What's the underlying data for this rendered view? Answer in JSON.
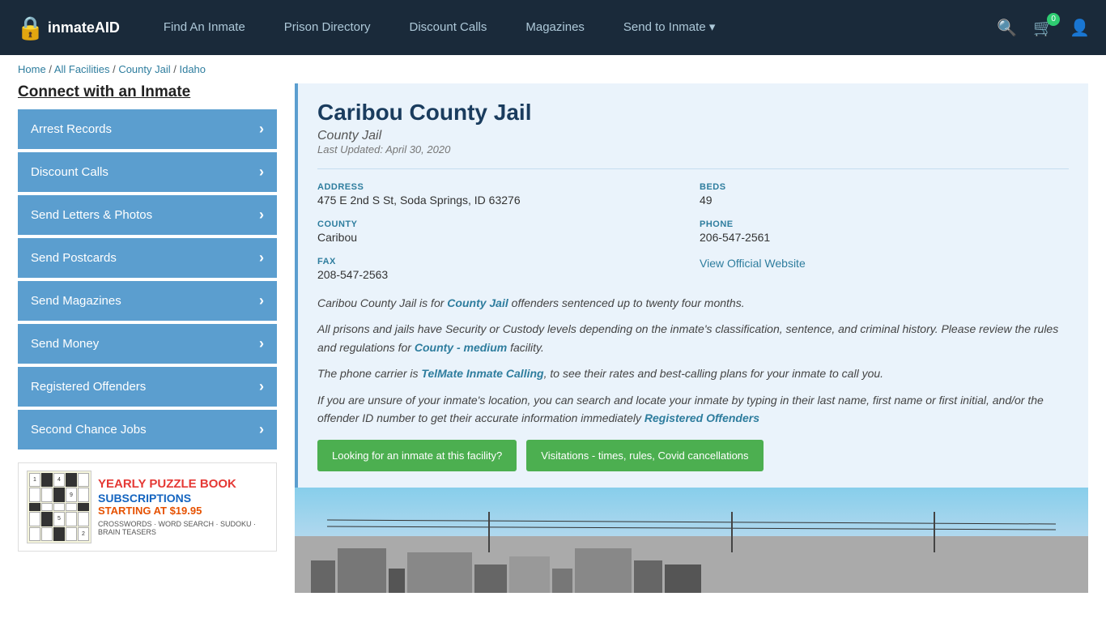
{
  "nav": {
    "logo_text": "inmateAID",
    "links": [
      {
        "label": "Find An Inmate",
        "id": "find-inmate"
      },
      {
        "label": "Prison Directory",
        "id": "prison-directory"
      },
      {
        "label": "Discount Calls",
        "id": "discount-calls"
      },
      {
        "label": "Magazines",
        "id": "magazines"
      },
      {
        "label": "Send to Inmate ▾",
        "id": "send-to-inmate"
      }
    ],
    "cart_count": "0",
    "icons": {
      "search": "🔍",
      "cart": "🛒",
      "user": "👤"
    }
  },
  "breadcrumb": {
    "items": [
      "Home",
      "All Facilities",
      "County Jail",
      "Idaho"
    ]
  },
  "sidebar": {
    "title": "Connect with an Inmate",
    "menu": [
      {
        "label": "Arrest Records",
        "id": "arrest-records"
      },
      {
        "label": "Discount Calls",
        "id": "discount-calls"
      },
      {
        "label": "Send Letters & Photos",
        "id": "send-letters"
      },
      {
        "label": "Send Postcards",
        "id": "send-postcards"
      },
      {
        "label": "Send Magazines",
        "id": "send-magazines"
      },
      {
        "label": "Send Money",
        "id": "send-money"
      },
      {
        "label": "Registered Offenders",
        "id": "registered-offenders"
      },
      {
        "label": "Second Chance Jobs",
        "id": "second-chance-jobs"
      }
    ],
    "ad": {
      "title": "YEARLY PUZZLE BOOK",
      "subtitle": "SUBSCRIPTIONS",
      "price": "STARTING AT $19.95",
      "types": "CROSSWORDS · WORD SEARCH · SUDOKU · BRAIN TEASERS"
    }
  },
  "facility": {
    "name": "Caribou County Jail",
    "type": "County Jail",
    "last_updated": "Last Updated: April 30, 2020",
    "address_label": "ADDRESS",
    "address_value": "475 E 2nd S St, Soda Springs, ID 63276",
    "beds_label": "BEDS",
    "beds_value": "49",
    "county_label": "COUNTY",
    "county_value": "Caribou",
    "phone_label": "PHONE",
    "phone_value": "206-547-2561",
    "fax_label": "FAX",
    "fax_value": "208-547-2563",
    "website_label": "View Official Website",
    "desc1": "Caribou County Jail is for County Jail offenders sentenced up to twenty four months.",
    "desc2": "All prisons and jails have Security or Custody levels depending on the inmate's classification, sentence, and criminal history. Please review the rules and regulations for County - medium facility.",
    "desc3": "The phone carrier is TelMate Inmate Calling, to see their rates and best-calling plans for your inmate to call you.",
    "desc4": "If you are unsure of your inmate's location, you can search and locate your inmate by typing in their last name, first name or first initial, and/or the offender ID number to get their accurate information immediately Registered Offenders",
    "btn1": "Looking for an inmate at this facility?",
    "btn2": "Visitations - times, rules, Covid cancellations"
  }
}
